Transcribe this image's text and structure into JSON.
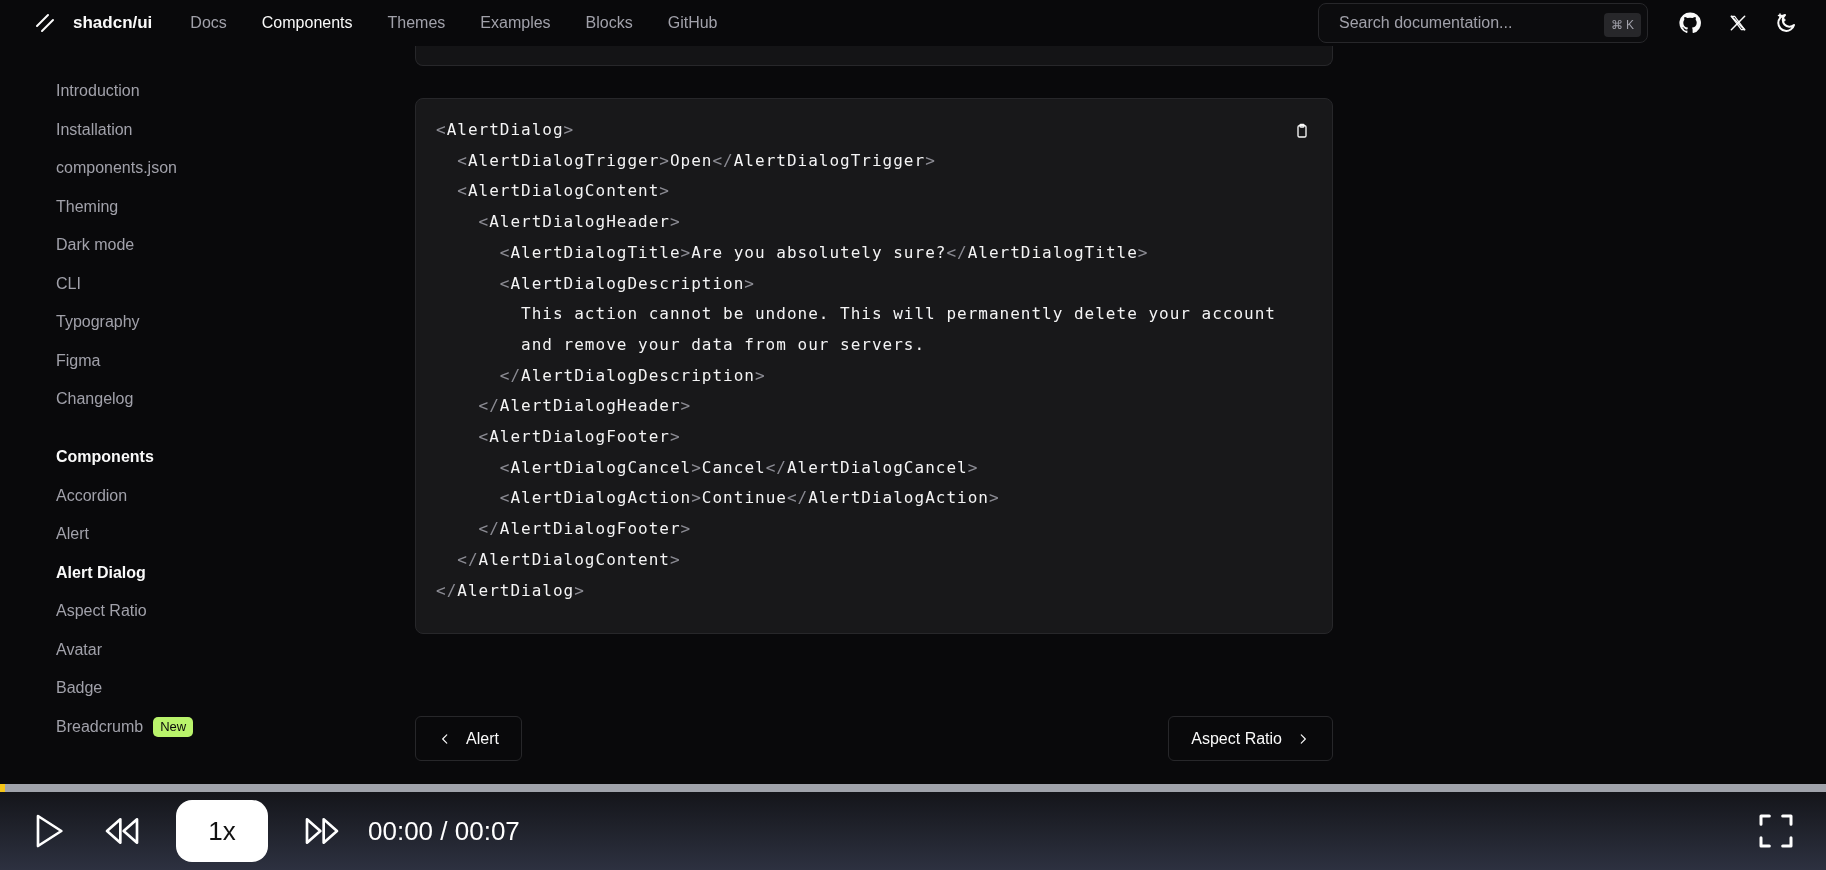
{
  "header": {
    "logo": "shadcn/ui",
    "nav": [
      {
        "label": "Docs",
        "selected": false
      },
      {
        "label": "Components",
        "selected": true
      },
      {
        "label": "Themes",
        "selected": false
      },
      {
        "label": "Examples",
        "selected": false
      },
      {
        "label": "Blocks",
        "selected": false
      },
      {
        "label": "GitHub",
        "selected": false
      }
    ],
    "search": {
      "placeholder": "Search documentation...",
      "shortcut": "⌘ K"
    }
  },
  "sidebar": {
    "sections": [
      {
        "items": [
          {
            "label": "Introduction",
            "selected": false
          },
          {
            "label": "Installation",
            "selected": false
          },
          {
            "label": "components.json",
            "selected": false
          },
          {
            "label": "Theming",
            "selected": false
          },
          {
            "label": "Dark mode",
            "selected": false
          },
          {
            "label": "CLI",
            "selected": false
          },
          {
            "label": "Typography",
            "selected": false
          },
          {
            "label": "Figma",
            "selected": false
          },
          {
            "label": "Changelog",
            "selected": false
          }
        ]
      },
      {
        "heading": "Components",
        "items": [
          {
            "label": "Accordion",
            "selected": false
          },
          {
            "label": "Alert",
            "selected": false
          },
          {
            "label": "Alert Dialog",
            "selected": true
          },
          {
            "label": "Aspect Ratio",
            "selected": false
          },
          {
            "label": "Avatar",
            "selected": false
          },
          {
            "label": "Badge",
            "selected": false
          },
          {
            "label": "Breadcrumb",
            "selected": false,
            "badge": "New"
          }
        ]
      }
    ]
  },
  "code_block": {
    "lines": [
      "<AlertDialog>",
      "  <AlertDialogTrigger>Open</AlertDialogTrigger>",
      "  <AlertDialogContent>",
      "    <AlertDialogHeader>",
      "      <AlertDialogTitle>Are you absolutely sure?</AlertDialogTitle>",
      "      <AlertDialogDescription>",
      "        This action cannot be undone. This will permanently delete your account",
      "        and remove your data from our servers.",
      "      </AlertDialogDescription>",
      "    </AlertDialogHeader>",
      "    <AlertDialogFooter>",
      "      <AlertDialogCancel>Cancel</AlertDialogCancel>",
      "      <AlertDialogAction>Continue</AlertDialogAction>",
      "    </AlertDialogFooter>",
      "  </AlertDialogContent>",
      "</AlertDialog>"
    ]
  },
  "pager": {
    "previous": "Alert",
    "next": "Aspect Ratio"
  },
  "player": {
    "progress": {
      "level": 0.003
    },
    "speed": "1x",
    "time": "00:00 / 00:07"
  }
}
